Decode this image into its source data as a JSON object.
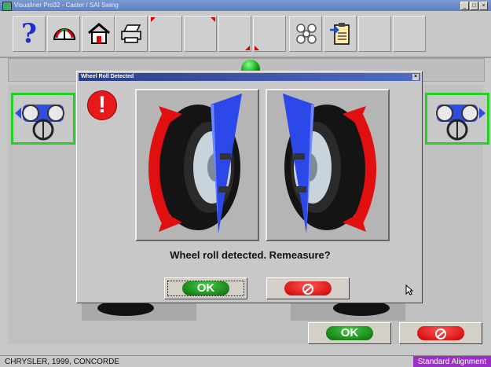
{
  "window": {
    "title": "Visualiner Pro32 - Caster / SAI Swing"
  },
  "toolbar": {
    "buttons": [
      {
        "name": "help",
        "glyph": "?"
      },
      {
        "name": "gauge"
      },
      {
        "name": "home"
      },
      {
        "name": "printer"
      },
      {
        "name": "blank-1"
      },
      {
        "name": "blank-2"
      },
      {
        "name": "blank-3"
      },
      {
        "name": "blank-4"
      },
      {
        "name": "settings"
      },
      {
        "name": "clipboard"
      },
      {
        "name": "blank-5"
      },
      {
        "name": "blank-6"
      }
    ]
  },
  "dialog": {
    "title": "Wheel Roll Detected",
    "close_glyph": "×",
    "alert_glyph": "!",
    "message": "Wheel roll detected. Remeasure?",
    "ok_label": "OK",
    "cancel_icon": "no-entry-icon"
  },
  "footer": {
    "ok_label": "OK",
    "cancel_icon": "no-entry-icon"
  },
  "status": {
    "vehicle": "CHRYSLER, 1999, CONCORDE",
    "mode": "Standard Alignment"
  },
  "colors": {
    "accent_purple": "#9b30c9",
    "ok_green": "#0a8a0a",
    "cancel_red": "#e01010",
    "panel_green": "#25d025",
    "alert_red": "#e61a1a"
  }
}
